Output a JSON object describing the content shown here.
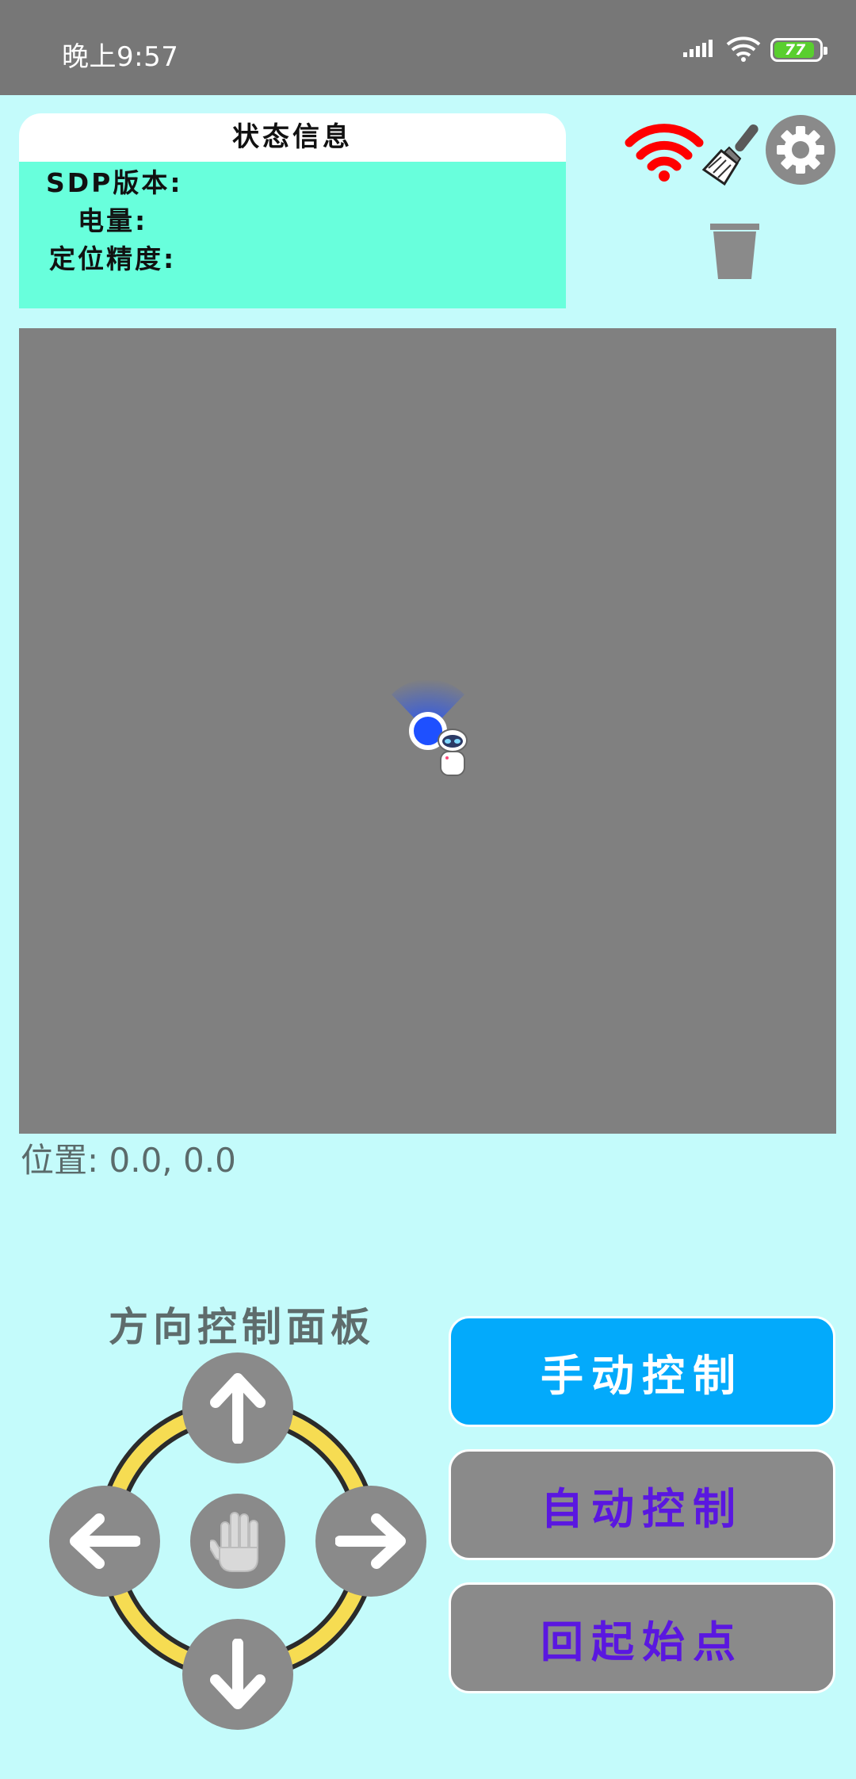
{
  "status_bar": {
    "time": "晚上9:57",
    "battery": "77"
  },
  "info_card": {
    "title": "状态信息",
    "sdp_label": "SDP版本:",
    "battery_label": "电量:",
    "accuracy_label": "定位精度:"
  },
  "toolbar": {
    "icons": [
      "wifi-icon",
      "brush-icon",
      "settings-icon",
      "trash-icon"
    ]
  },
  "map": {
    "position_text": "位置: 0.0, 0.0"
  },
  "direction_panel": {
    "title": "方向控制面板",
    "buttons": [
      "arrow-up-icon",
      "arrow-left-icon",
      "stop-hand-icon",
      "arrow-right-icon",
      "arrow-down-icon"
    ]
  },
  "modes": {
    "manual": "手动控制",
    "auto": "自动控制",
    "home": "回起始点"
  },
  "colors": {
    "background": "#c4fbfb",
    "manual_active": "#03aafb",
    "mode_text": "#5a17e0",
    "info_body": "#68ffdc",
    "wifi_red": "#ff0000"
  }
}
